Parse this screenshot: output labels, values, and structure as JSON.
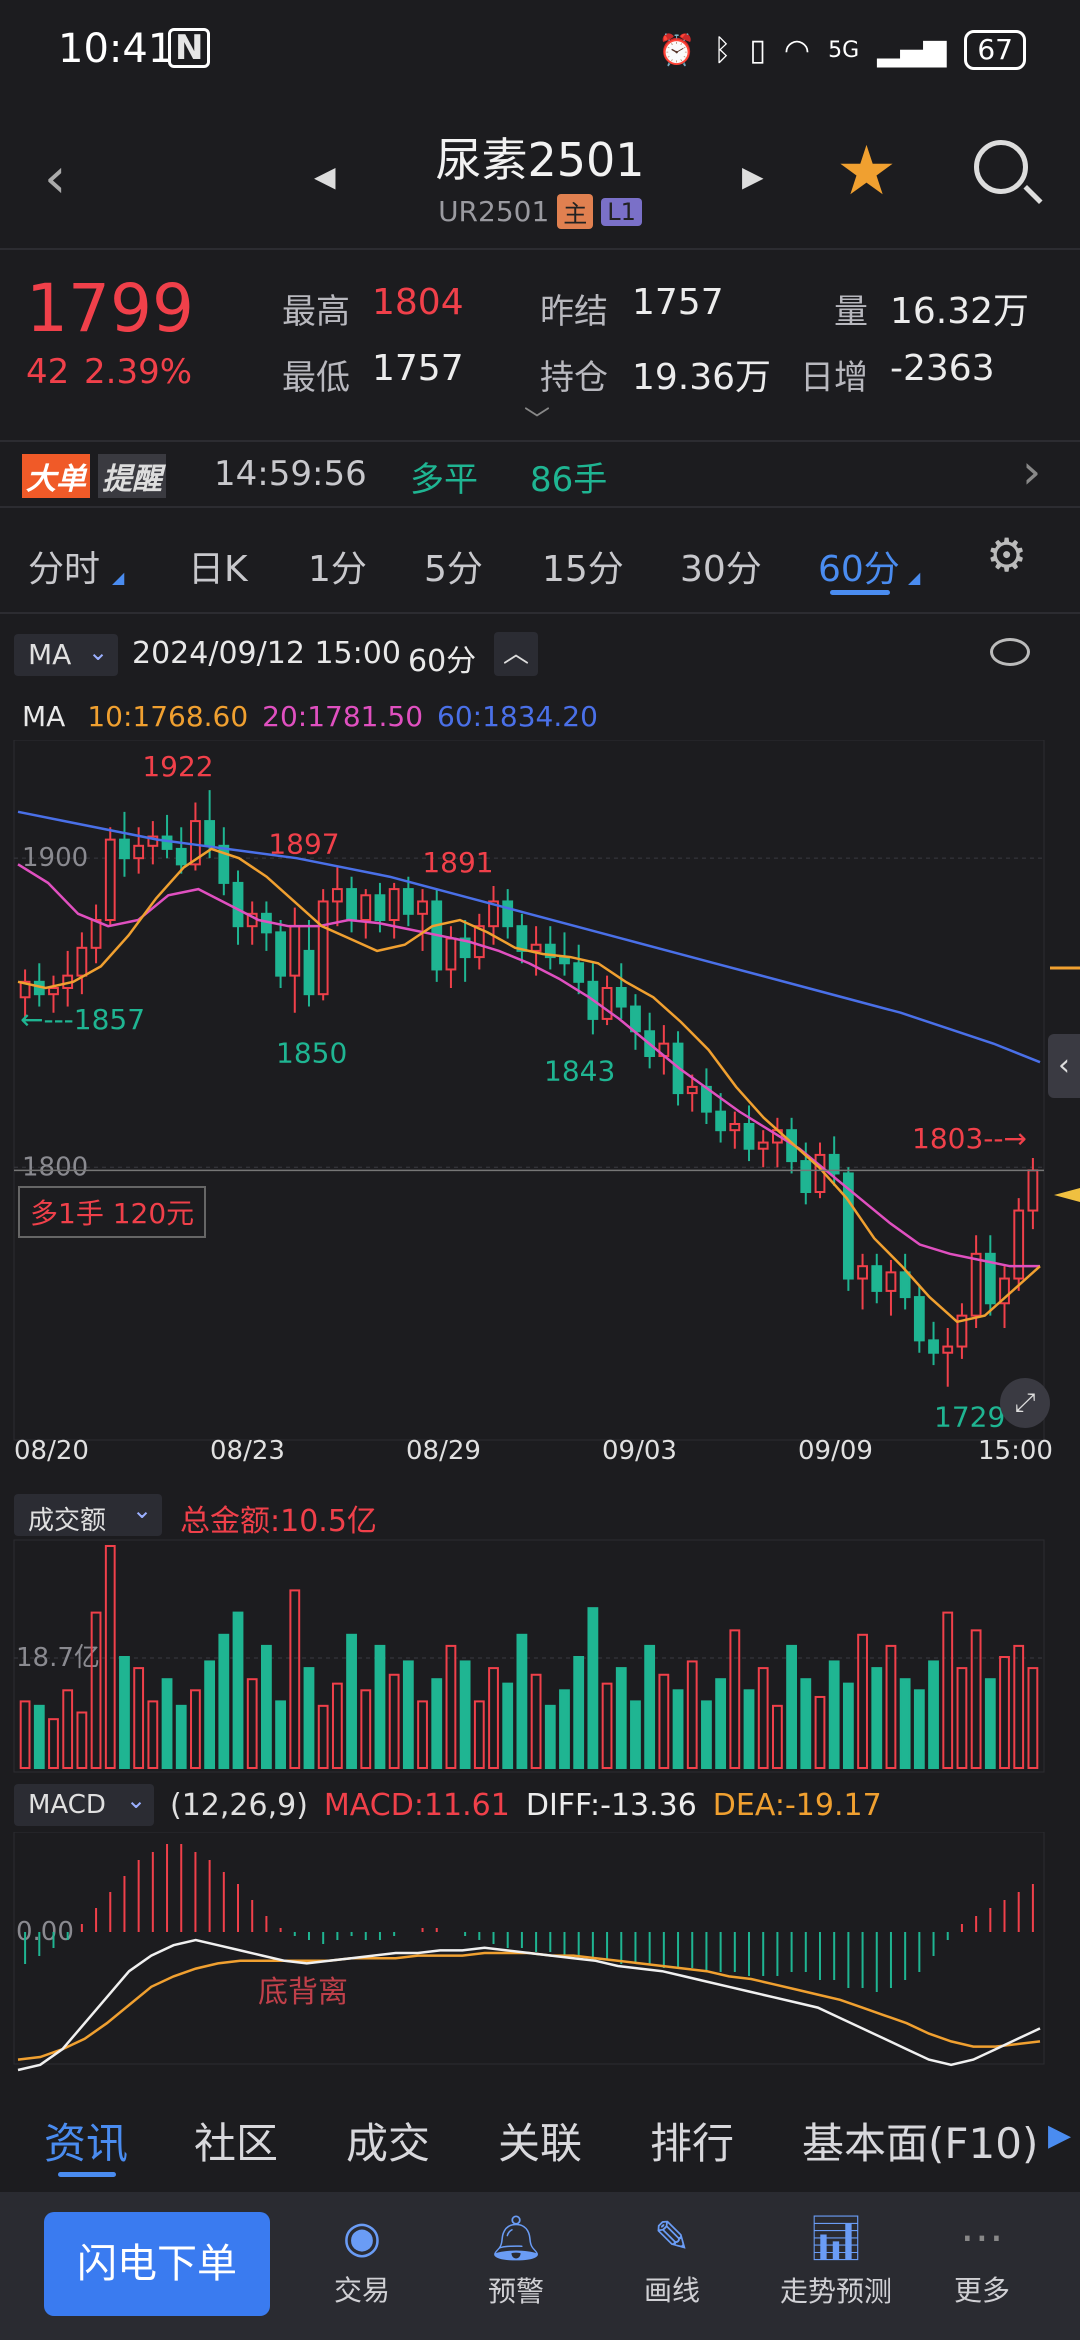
{
  "status": {
    "time": "10:41",
    "nfc": "N",
    "network": "5G",
    "battery": "67"
  },
  "header": {
    "title": "尿素2501",
    "code": "UR2501",
    "badge_main": "主",
    "badge_level": "L1"
  },
  "quote": {
    "price": "1799",
    "change": "42",
    "change_pct": "2.39%",
    "high_label": "最高",
    "high": "1804",
    "low_label": "最低",
    "low": "1757",
    "prev_label": "昨结",
    "prev": "1757",
    "oi_label": "持仓",
    "oi": "19.36万",
    "vol_label": "量",
    "vol": "16.32万",
    "daily_label": "日增",
    "daily": "-2363"
  },
  "alert": {
    "tag1": "大单",
    "tag2": "提醒",
    "time": "14:59:56",
    "action": "多平",
    "qty": "86手"
  },
  "ktabs": [
    "分时",
    "日K",
    "1分",
    "5分",
    "15分",
    "30分",
    "60分"
  ],
  "ktabs_active": "60分",
  "chart_bar": {
    "indicator": "MA",
    "datetime": "2024/09/12 15:00",
    "period": "60分"
  },
  "ma": {
    "label": "MA",
    "ma10": "10:1768.60",
    "ma20": "20:1781.50",
    "ma60": "60:1834.20",
    "c10": "#f0a030",
    "c20": "#e050c0",
    "c60": "#4a70e8"
  },
  "position": {
    "text": "多1手  120元"
  },
  "chart_data": {
    "type": "candlestick",
    "price_axis_labels": [
      "1900",
      "1800"
    ],
    "x_labels": [
      "08/20",
      "08/23",
      "08/29",
      "09/03",
      "09/09",
      "15:00"
    ],
    "annotations": [
      "1922",
      "1897",
      "1891",
      "1857",
      "1850",
      "1843",
      "1803",
      "1729"
    ],
    "arrow_left_label": "←---1857",
    "arrow_right_label": "1803--→",
    "ylim": [
      1715,
      1935
    ],
    "candles": [
      [
        1855,
        1864,
        1848,
        1860
      ],
      [
        1860,
        1866,
        1852,
        1856
      ],
      [
        1856,
        1862,
        1850,
        1858
      ],
      [
        1858,
        1870,
        1852,
        1862
      ],
      [
        1862,
        1876,
        1856,
        1871
      ],
      [
        1871,
        1885,
        1866,
        1880
      ],
      [
        1880,
        1910,
        1878,
        1906
      ],
      [
        1906,
        1915,
        1894,
        1900
      ],
      [
        1900,
        1910,
        1895,
        1904
      ],
      [
        1904,
        1912,
        1898,
        1907
      ],
      [
        1907,
        1914,
        1900,
        1903
      ],
      [
        1903,
        1910,
        1895,
        1898
      ],
      [
        1898,
        1918,
        1896,
        1912
      ],
      [
        1912,
        1922,
        1900,
        1904
      ],
      [
        1904,
        1910,
        1888,
        1892
      ],
      [
        1892,
        1896,
        1872,
        1878
      ],
      [
        1878,
        1886,
        1872,
        1882
      ],
      [
        1882,
        1886,
        1870,
        1876
      ],
      [
        1876,
        1880,
        1858,
        1862
      ],
      [
        1862,
        1884,
        1850,
        1878
      ],
      [
        1870,
        1880,
        1852,
        1856
      ],
      [
        1856,
        1890,
        1854,
        1886
      ],
      [
        1886,
        1897,
        1878,
        1890
      ],
      [
        1890,
        1894,
        1876,
        1880
      ],
      [
        1880,
        1890,
        1874,
        1888
      ],
      [
        1888,
        1892,
        1876,
        1880
      ],
      [
        1880,
        1892,
        1874,
        1890
      ],
      [
        1890,
        1894,
        1878,
        1882
      ],
      [
        1882,
        1890,
        1870,
        1886
      ],
      [
        1886,
        1890,
        1860,
        1864
      ],
      [
        1864,
        1878,
        1858,
        1874
      ],
      [
        1874,
        1880,
        1860,
        1868
      ],
      [
        1868,
        1882,
        1864,
        1878
      ],
      [
        1878,
        1891,
        1872,
        1886
      ],
      [
        1886,
        1890,
        1874,
        1878
      ],
      [
        1878,
        1882,
        1866,
        1870
      ],
      [
        1870,
        1878,
        1862,
        1872
      ],
      [
        1872,
        1878,
        1864,
        1868
      ],
      [
        1868,
        1876,
        1862,
        1866
      ],
      [
        1866,
        1872,
        1856,
        1860
      ],
      [
        1860,
        1866,
        1843,
        1848
      ],
      [
        1848,
        1862,
        1846,
        1858
      ],
      [
        1858,
        1866,
        1848,
        1852
      ],
      [
        1852,
        1856,
        1838,
        1844
      ],
      [
        1844,
        1850,
        1832,
        1836
      ],
      [
        1836,
        1846,
        1830,
        1840
      ],
      [
        1840,
        1844,
        1820,
        1824
      ],
      [
        1824,
        1830,
        1818,
        1826
      ],
      [
        1826,
        1832,
        1814,
        1818
      ],
      [
        1818,
        1824,
        1808,
        1812
      ],
      [
        1812,
        1818,
        1806,
        1814
      ],
      [
        1814,
        1820,
        1802,
        1806
      ],
      [
        1806,
        1812,
        1800,
        1808
      ],
      [
        1808,
        1816,
        1800,
        1812
      ],
      [
        1812,
        1816,
        1798,
        1802
      ],
      [
        1802,
        1808,
        1788,
        1792
      ],
      [
        1792,
        1808,
        1790,
        1804
      ],
      [
        1804,
        1810,
        1794,
        1798
      ],
      [
        1798,
        1800,
        1760,
        1764
      ],
      [
        1764,
        1772,
        1754,
        1768
      ],
      [
        1768,
        1772,
        1756,
        1760
      ],
      [
        1760,
        1770,
        1752,
        1766
      ],
      [
        1766,
        1772,
        1754,
        1758
      ],
      [
        1758,
        1762,
        1740,
        1744
      ],
      [
        1744,
        1750,
        1736,
        1740
      ],
      [
        1740,
        1748,
        1729,
        1742
      ],
      [
        1742,
        1756,
        1738,
        1752
      ],
      [
        1752,
        1778,
        1748,
        1772
      ],
      [
        1772,
        1778,
        1752,
        1756
      ],
      [
        1756,
        1768,
        1748,
        1764
      ],
      [
        1764,
        1790,
        1760,
        1786
      ],
      [
        1786,
        1803,
        1780,
        1799
      ]
    ],
    "ma10": [
      1860,
      1858,
      1860,
      1865,
      1875,
      1887,
      1897,
      1903,
      1900,
      1894,
      1886,
      1878,
      1874,
      1870,
      1872,
      1878,
      1880,
      1876,
      1871,
      1869,
      1868,
      1866,
      1860,
      1855,
      1847,
      1838,
      1826,
      1816,
      1808,
      1800,
      1790,
      1777,
      1768,
      1758,
      1750,
      1752,
      1760,
      1768
    ],
    "ma20": [
      1898,
      1892,
      1882,
      1878,
      1880,
      1888,
      1890,
      1885,
      1880,
      1878,
      1878,
      1880,
      1879,
      1877,
      1875,
      1873,
      1870,
      1866,
      1861,
      1855,
      1848,
      1840,
      1832,
      1825,
      1818,
      1812,
      1806,
      1798,
      1790,
      1782,
      1775,
      1772,
      1770,
      1768,
      1768
    ],
    "ma60": [
      1915,
      1912,
      1909,
      1906,
      1904,
      1902,
      1900,
      1897,
      1894,
      1890,
      1886,
      1882,
      1878,
      1874,
      1870,
      1866,
      1862,
      1858,
      1854,
      1850,
      1845,
      1840,
      1834
    ],
    "volume_title": "成交额",
    "volume_total": "总金额:10.5亿",
    "volume_axis_label": "18.7亿",
    "volumes": [
      30,
      28,
      22,
      35,
      25,
      70,
      100,
      50,
      45,
      30,
      40,
      28,
      35,
      48,
      60,
      70,
      40,
      55,
      30,
      80,
      45,
      28,
      38,
      60,
      35,
      55,
      42,
      48,
      30,
      40,
      55,
      48,
      30,
      45,
      38,
      60,
      42,
      28,
      35,
      50,
      72,
      38,
      45,
      30,
      55,
      42,
      35,
      48,
      30,
      40,
      62,
      35,
      45,
      28,
      55,
      40,
      32,
      48,
      38,
      60,
      45,
      55,
      40,
      35,
      48,
      70,
      45,
      62,
      40,
      50,
      55,
      45
    ],
    "macd_title": "MACD",
    "macd_params": "(12,26,9)",
    "macd_value": "MACD:11.61",
    "diff_value": "DIFF:-13.36",
    "dea_value": "DEA:-19.17",
    "macd_axis_label": "0.00",
    "divergence_label": "底背离",
    "macd_hist": [
      -8,
      -6,
      -4,
      -2,
      2,
      6,
      10,
      14,
      18,
      20,
      22,
      22,
      20,
      18,
      15,
      12,
      8,
      4,
      1,
      -1,
      -2,
      -3,
      -2,
      -1,
      -2,
      -2,
      -1,
      0,
      1,
      1,
      0,
      -1,
      -2,
      -3,
      -4,
      -4,
      -5,
      -5,
      -6,
      -6,
      -7,
      -7,
      -8,
      -8,
      -8,
      -9,
      -9,
      -9,
      -10,
      -10,
      -10,
      -11,
      -11,
      -11,
      -10,
      -10,
      -12,
      -12,
      -14,
      -14,
      -15,
      -14,
      -12,
      -10,
      -6,
      -2,
      2,
      4,
      6,
      8,
      10,
      12
    ],
    "macd_diff": [
      -30,
      -28,
      -22,
      -12,
      -2,
      8,
      14,
      18,
      20,
      18,
      16,
      14,
      12,
      11,
      12,
      13,
      14,
      15,
      15,
      16,
      16,
      17,
      16,
      15,
      14,
      13,
      12,
      10,
      9,
      8,
      6,
      4,
      2,
      0,
      -2,
      -4,
      -6,
      -10,
      -14,
      -18,
      -22,
      -26,
      -28,
      -26,
      -22,
      -18,
      -14
    ],
    "macd_dea": [
      -26,
      -25,
      -22,
      -18,
      -12,
      -5,
      2,
      6,
      9,
      11,
      12,
      12,
      12,
      12,
      12,
      13,
      13,
      13,
      14,
      14,
      14,
      15,
      15,
      15,
      14,
      14,
      13,
      12,
      11,
      10,
      9,
      8,
      6,
      5,
      3,
      1,
      -1,
      -3,
      -6,
      -9,
      -12,
      -16,
      -19,
      -21,
      -21,
      -20,
      -19
    ]
  },
  "chart_colors": {
    "up": "#f0404a",
    "down": "#1fb592",
    "ma10": "#f0a030",
    "ma20": "#e050c0",
    "ma60": "#4a70e8",
    "diff": "#f0f0f0",
    "dea": "#f0a030"
  },
  "bottom_tabs": [
    "资讯",
    "社区",
    "成交",
    "关联",
    "排行",
    "基本面(F10)"
  ],
  "bottom_active": "资讯",
  "toolbar": {
    "order_button": "闪电下单",
    "items": [
      "交易",
      "预警",
      "画线",
      "走势预测",
      "更多"
    ]
  }
}
